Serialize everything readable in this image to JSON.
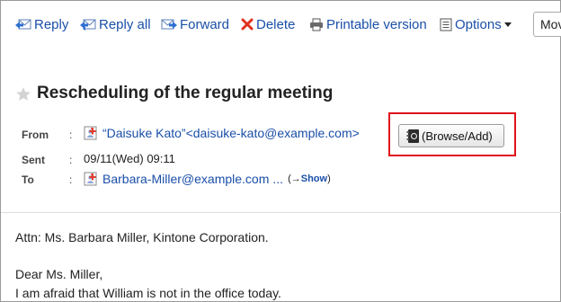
{
  "toolbar": {
    "reply": "Reply",
    "reply_all": "Reply all",
    "forward": "Forward",
    "delete": "Delete",
    "printable": "Printable version",
    "options": "Options",
    "move": "Mov"
  },
  "message": {
    "subject": "Rescheduling of the regular meeting",
    "from_label": "From",
    "from_value": "“Daisuke Kato”<daisuke-kato@example.com>",
    "browse_add": "(Browse/Add)",
    "sent_label": "Sent",
    "sent_value": "09/11(Wed) 09:11",
    "to_label": "To",
    "to_value": "Barbara-Miller@example.com",
    "to_more": "...",
    "show_prefix": "(→",
    "show_link": "Show",
    "show_suffix": ")",
    "colon": ":"
  },
  "body": {
    "line1": "Attn: Ms. Barbara Miller, Kintone Corporation.",
    "line2": "Dear Ms. Miller,",
    "line3": "I am afraid that William is not in the office today."
  }
}
